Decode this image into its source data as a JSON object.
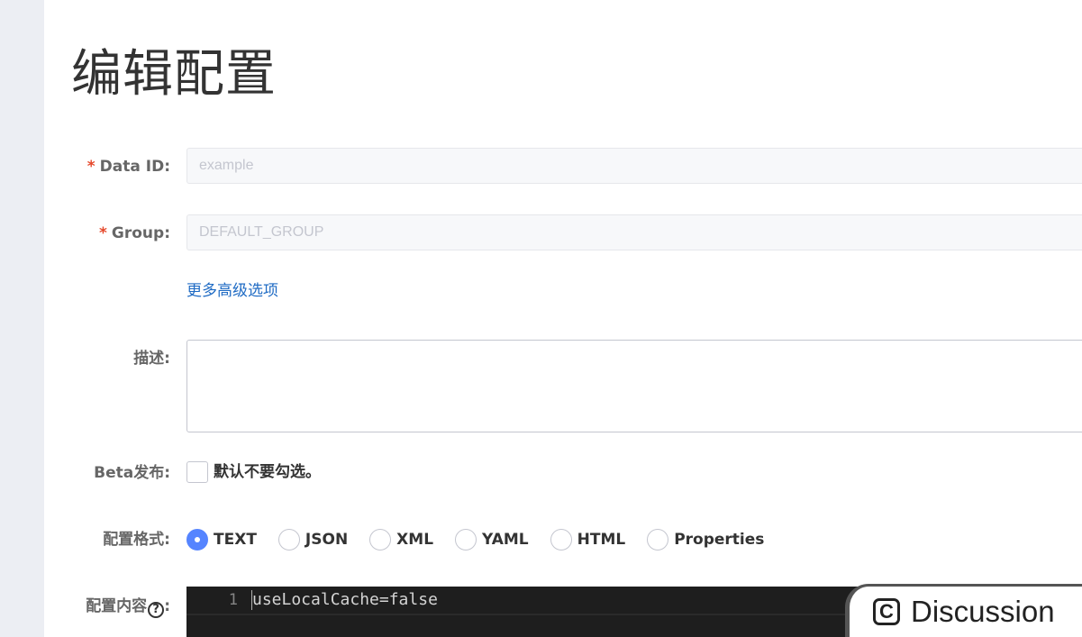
{
  "page_title": "编辑配置",
  "form": {
    "data_id": {
      "required_mark": "*",
      "label": "Data ID:",
      "value": "example"
    },
    "group": {
      "required_mark": "*",
      "label": "Group:",
      "value": "DEFAULT_GROUP"
    },
    "advanced_link": "更多高级选项",
    "description": {
      "label": "描述:",
      "value": ""
    },
    "beta": {
      "label": "Beta发布:",
      "checkbox_text": "默认不要勾选。",
      "checked": false
    },
    "format": {
      "label": "配置格式:",
      "selected": "TEXT",
      "options": [
        "TEXT",
        "JSON",
        "XML",
        "YAML",
        "HTML",
        "Properties"
      ]
    },
    "content": {
      "label": "配置内容",
      "label_suffix": ":",
      "help_icon_glyph": "?",
      "lines": [
        {
          "number": "1",
          "text": "useLocalCache=false"
        }
      ]
    }
  },
  "discussion": {
    "icon_glyph": "C",
    "label": "Discussion"
  },
  "colors": {
    "accent": "#5584ff",
    "required": "#e5482b",
    "link": "#1f6bc4",
    "editor_bg": "#1e1e1e"
  }
}
